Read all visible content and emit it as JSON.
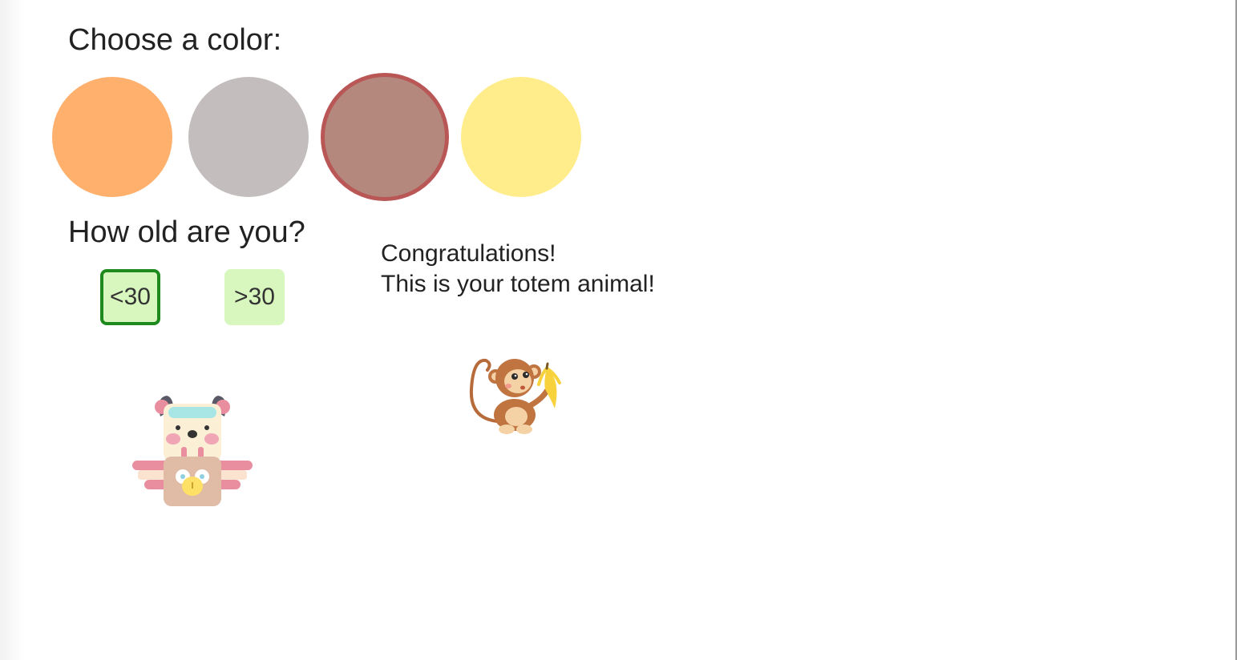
{
  "color_section": {
    "heading": "Choose a color:",
    "options": [
      {
        "name": "orange",
        "color": "#FFB06D",
        "selected": false
      },
      {
        "name": "gray",
        "color": "#C3BDBD",
        "selected": false
      },
      {
        "name": "brown",
        "color": "#B5887D",
        "selected": true,
        "border_color": "#B95656"
      },
      {
        "name": "yellow",
        "color": "#FFEC8A",
        "selected": false
      }
    ]
  },
  "age_section": {
    "heading": "How old are you?",
    "options": [
      {
        "label": "<30",
        "selected": true
      },
      {
        "label": ">30",
        "selected": false
      }
    ],
    "button_bg": "#D8F7BE",
    "selected_border_color": "#1E8A1E"
  },
  "result": {
    "line1": "Congratulations!",
    "line2": "This is your totem animal!",
    "animal_icon": "monkey-with-banana-icon"
  },
  "decorative_icon": "totem-pole-icon"
}
